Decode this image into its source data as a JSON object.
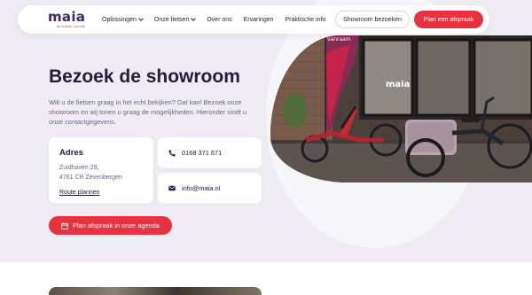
{
  "nav": {
    "logo_text": "maia",
    "logo_tagline": "be mobile. live life",
    "links": [
      {
        "label": "Oplossingen",
        "has_dropdown": true
      },
      {
        "label": "Onze fietsen",
        "has_dropdown": true
      },
      {
        "label": "Over ons",
        "has_dropdown": false
      },
      {
        "label": "Ervaringen",
        "has_dropdown": false
      },
      {
        "label": "Praktische info",
        "has_dropdown": false
      }
    ],
    "showroom_button": "Showroom bezoeken",
    "appointment_button": "Plan een afspraak"
  },
  "hero": {
    "title": "Bezoek de showroom",
    "intro": "Wilt u de fietsen graag in het echt bekijken? Dat kan! Bezoek onze showroom en wij tonen u graag de mogelijkheden. Hieronder vindt u onze contactgegevens.",
    "photo_storefront_sign": "maia",
    "photo_flag_text": "vanraam"
  },
  "address": {
    "title": "Adres",
    "line1": "Zuidhaven 29,",
    "line2": "4761 CR Zevenbergen",
    "link": "Route plannen"
  },
  "phone": {
    "value": "0168 371 671",
    "icon": "phone-icon"
  },
  "email": {
    "value": "info@maia.nl",
    "icon": "mail-icon"
  },
  "agenda_button": {
    "label": "Plan afspraak in onze agenda",
    "icon": "calendar-icon"
  },
  "colors": {
    "accent": "#e8323f",
    "brand": "#3b2a63",
    "background": "#efedf3"
  }
}
